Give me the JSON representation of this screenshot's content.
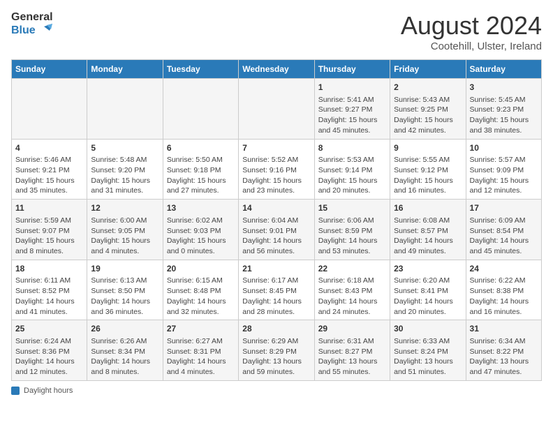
{
  "header": {
    "logo_general": "General",
    "logo_blue": "Blue",
    "month_year": "August 2024",
    "location": "Cootehill, Ulster, Ireland"
  },
  "days_of_week": [
    "Sunday",
    "Monday",
    "Tuesday",
    "Wednesday",
    "Thursday",
    "Friday",
    "Saturday"
  ],
  "weeks": [
    [
      {
        "day": "",
        "info": ""
      },
      {
        "day": "",
        "info": ""
      },
      {
        "day": "",
        "info": ""
      },
      {
        "day": "",
        "info": ""
      },
      {
        "day": "1",
        "info": "Sunrise: 5:41 AM\nSunset: 9:27 PM\nDaylight: 15 hours\nand 45 minutes."
      },
      {
        "day": "2",
        "info": "Sunrise: 5:43 AM\nSunset: 9:25 PM\nDaylight: 15 hours\nand 42 minutes."
      },
      {
        "day": "3",
        "info": "Sunrise: 5:45 AM\nSunset: 9:23 PM\nDaylight: 15 hours\nand 38 minutes."
      }
    ],
    [
      {
        "day": "4",
        "info": "Sunrise: 5:46 AM\nSunset: 9:21 PM\nDaylight: 15 hours\nand 35 minutes."
      },
      {
        "day": "5",
        "info": "Sunrise: 5:48 AM\nSunset: 9:20 PM\nDaylight: 15 hours\nand 31 minutes."
      },
      {
        "day": "6",
        "info": "Sunrise: 5:50 AM\nSunset: 9:18 PM\nDaylight: 15 hours\nand 27 minutes."
      },
      {
        "day": "7",
        "info": "Sunrise: 5:52 AM\nSunset: 9:16 PM\nDaylight: 15 hours\nand 23 minutes."
      },
      {
        "day": "8",
        "info": "Sunrise: 5:53 AM\nSunset: 9:14 PM\nDaylight: 15 hours\nand 20 minutes."
      },
      {
        "day": "9",
        "info": "Sunrise: 5:55 AM\nSunset: 9:12 PM\nDaylight: 15 hours\nand 16 minutes."
      },
      {
        "day": "10",
        "info": "Sunrise: 5:57 AM\nSunset: 9:09 PM\nDaylight: 15 hours\nand 12 minutes."
      }
    ],
    [
      {
        "day": "11",
        "info": "Sunrise: 5:59 AM\nSunset: 9:07 PM\nDaylight: 15 hours\nand 8 minutes."
      },
      {
        "day": "12",
        "info": "Sunrise: 6:00 AM\nSunset: 9:05 PM\nDaylight: 15 hours\nand 4 minutes."
      },
      {
        "day": "13",
        "info": "Sunrise: 6:02 AM\nSunset: 9:03 PM\nDaylight: 15 hours\nand 0 minutes."
      },
      {
        "day": "14",
        "info": "Sunrise: 6:04 AM\nSunset: 9:01 PM\nDaylight: 14 hours\nand 56 minutes."
      },
      {
        "day": "15",
        "info": "Sunrise: 6:06 AM\nSunset: 8:59 PM\nDaylight: 14 hours\nand 53 minutes."
      },
      {
        "day": "16",
        "info": "Sunrise: 6:08 AM\nSunset: 8:57 PM\nDaylight: 14 hours\nand 49 minutes."
      },
      {
        "day": "17",
        "info": "Sunrise: 6:09 AM\nSunset: 8:54 PM\nDaylight: 14 hours\nand 45 minutes."
      }
    ],
    [
      {
        "day": "18",
        "info": "Sunrise: 6:11 AM\nSunset: 8:52 PM\nDaylight: 14 hours\nand 41 minutes."
      },
      {
        "day": "19",
        "info": "Sunrise: 6:13 AM\nSunset: 8:50 PM\nDaylight: 14 hours\nand 36 minutes."
      },
      {
        "day": "20",
        "info": "Sunrise: 6:15 AM\nSunset: 8:48 PM\nDaylight: 14 hours\nand 32 minutes."
      },
      {
        "day": "21",
        "info": "Sunrise: 6:17 AM\nSunset: 8:45 PM\nDaylight: 14 hours\nand 28 minutes."
      },
      {
        "day": "22",
        "info": "Sunrise: 6:18 AM\nSunset: 8:43 PM\nDaylight: 14 hours\nand 24 minutes."
      },
      {
        "day": "23",
        "info": "Sunrise: 6:20 AM\nSunset: 8:41 PM\nDaylight: 14 hours\nand 20 minutes."
      },
      {
        "day": "24",
        "info": "Sunrise: 6:22 AM\nSunset: 8:38 PM\nDaylight: 14 hours\nand 16 minutes."
      }
    ],
    [
      {
        "day": "25",
        "info": "Sunrise: 6:24 AM\nSunset: 8:36 PM\nDaylight: 14 hours\nand 12 minutes."
      },
      {
        "day": "26",
        "info": "Sunrise: 6:26 AM\nSunset: 8:34 PM\nDaylight: 14 hours\nand 8 minutes."
      },
      {
        "day": "27",
        "info": "Sunrise: 6:27 AM\nSunset: 8:31 PM\nDaylight: 14 hours\nand 4 minutes."
      },
      {
        "day": "28",
        "info": "Sunrise: 6:29 AM\nSunset: 8:29 PM\nDaylight: 13 hours\nand 59 minutes."
      },
      {
        "day": "29",
        "info": "Sunrise: 6:31 AM\nSunset: 8:27 PM\nDaylight: 13 hours\nand 55 minutes."
      },
      {
        "day": "30",
        "info": "Sunrise: 6:33 AM\nSunset: 8:24 PM\nDaylight: 13 hours\nand 51 minutes."
      },
      {
        "day": "31",
        "info": "Sunrise: 6:34 AM\nSunset: 8:22 PM\nDaylight: 13 hours\nand 47 minutes."
      }
    ]
  ],
  "footer": {
    "note": "Daylight hours"
  }
}
